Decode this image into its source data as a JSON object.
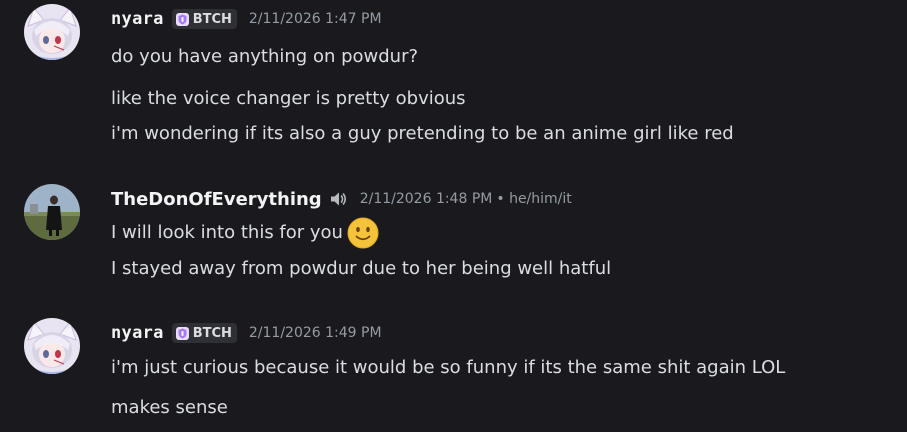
{
  "messages": [
    {
      "author": "nyara",
      "tag": "BTCH",
      "timestamp": "2/11/2026 1:47 PM",
      "lines": [
        "do you have anything on powdur?",
        "like the voice changer is pretty obvious",
        "i'm wondering if its also a guy pretending to be an anime girl like red"
      ]
    },
    {
      "author": "TheDonOfEverything",
      "timestamp": "2/11/2026 1:48 PM",
      "pronouns": "• he/him/it",
      "lines": [
        "I will look into this for you",
        "I stayed away from powdur due to her being well hatful"
      ],
      "emoji": "slightly-smiling-face"
    },
    {
      "author": "nyara",
      "tag": "BTCH",
      "timestamp": "2/11/2026 1:49 PM",
      "lines": [
        "i'm just curious because it would be so funny if its the same shit again LOL",
        "makes sense"
      ]
    }
  ],
  "colors": {
    "background": "#1a1a1e",
    "username": "#f2f3f5",
    "text": "#dbdee1",
    "muted": "#949ba4",
    "tag_bg": "#2f3036",
    "tag_icon": "#a57bf5"
  }
}
